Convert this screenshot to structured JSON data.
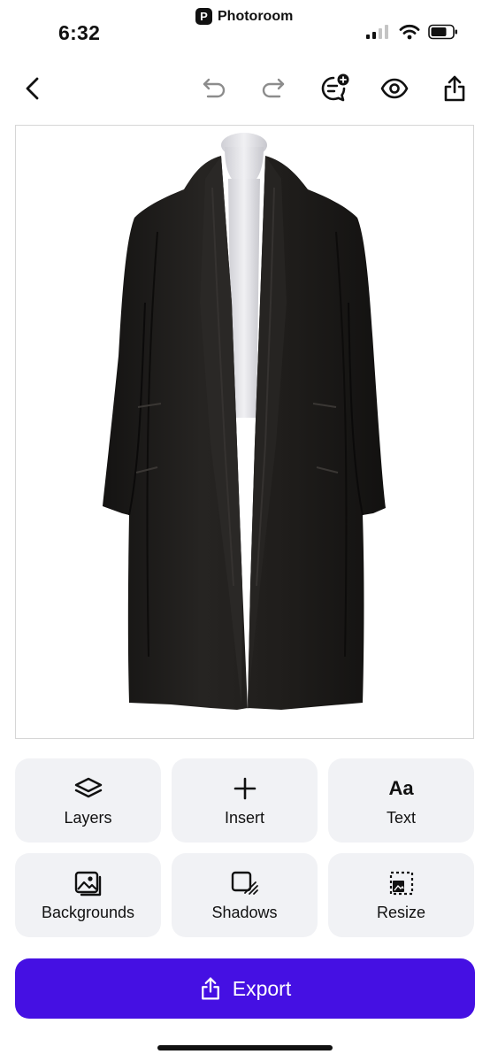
{
  "status": {
    "time": "6:32",
    "app_name": "Photoroom"
  },
  "toolbar": {
    "back_icon": "chevron-left-icon",
    "undo_icon": "undo-icon",
    "redo_icon": "redo-icon",
    "comment_icon": "comment-add-icon",
    "preview_icon": "eye-icon",
    "share_icon": "share-icon"
  },
  "tools": [
    {
      "label": "Layers",
      "icon": "layers-icon"
    },
    {
      "label": "Insert",
      "icon": "plus-icon"
    },
    {
      "label": "Text",
      "icon": "text-icon",
      "glyph": "Aa"
    },
    {
      "label": "Backgrounds",
      "icon": "backgrounds-icon"
    },
    {
      "label": "Shadows",
      "icon": "shadow-icon"
    },
    {
      "label": "Resize",
      "icon": "resize-icon"
    }
  ],
  "export": {
    "label": "Export",
    "icon": "share-icon"
  },
  "colors": {
    "accent": "#4510e3",
    "tile_bg": "#f1f2f5",
    "coat": "#1b1a19",
    "mannequin": "#e3e3e7"
  }
}
